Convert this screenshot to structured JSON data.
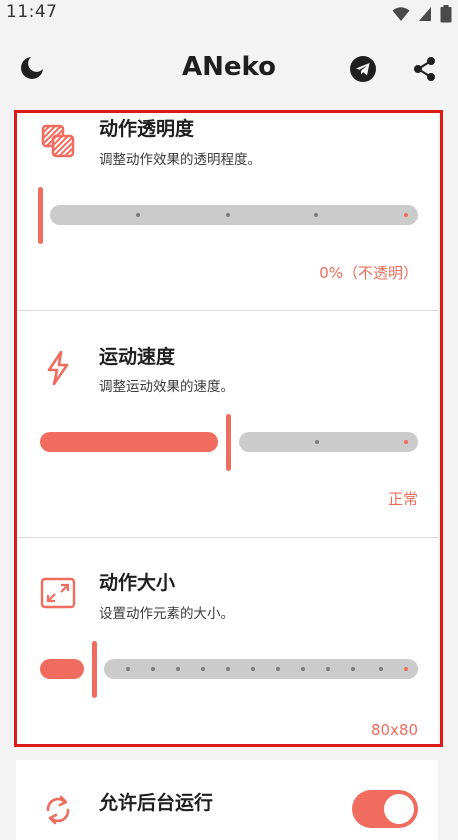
{
  "status_bar": {
    "time": "11:47"
  },
  "app_bar": {
    "title": "ANeko"
  },
  "settings": [
    {
      "title": "动作透明度",
      "description": "调整动作效果的透明程度。",
      "value": "0%（不透明）",
      "slider_fraction": 0.0
    },
    {
      "title": "运动速度",
      "description": "调整运动效果的速度。",
      "value": "正常",
      "slider_fraction": 0.5
    },
    {
      "title": "动作大小",
      "description": "设置动作元素的大小。",
      "value": "80x80",
      "slider_fraction": 0.143
    },
    {
      "title": "允许后台运行"
    }
  ],
  "colors": {
    "accent": "#f06c5e",
    "highlight": "#dc1a1a"
  },
  "icons": [
    "moon-icon",
    "telegram-icon",
    "share-icon",
    "opacity-icon",
    "lightning-icon",
    "resize-icon",
    "sync-icon"
  ]
}
